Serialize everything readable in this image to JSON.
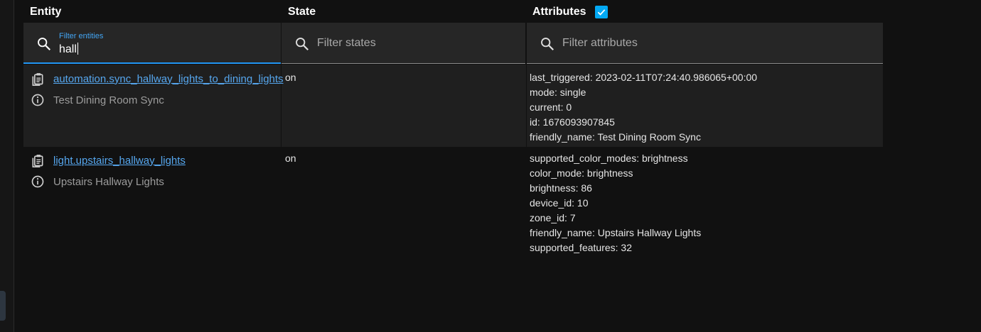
{
  "headers": {
    "entity": "Entity",
    "state": "State",
    "attributes": "Attributes",
    "attributes_checked": true
  },
  "filters": {
    "entity": {
      "label": "Filter entities",
      "value": "hall"
    },
    "state": {
      "placeholder": "Filter states"
    },
    "attributes": {
      "placeholder": "Filter attributes"
    }
  },
  "rows": [
    {
      "entity_id": "automation.sync_hallway_lights_to_dining_lights",
      "friendly_name": "Test Dining Room Sync",
      "state": "on",
      "attributes": [
        "last_triggered: 2023-02-11T07:24:40.986065+00:00",
        "mode: single",
        "current: 0",
        "id: 1676093907845",
        "friendly_name: Test Dining Room Sync"
      ]
    },
    {
      "entity_id": "light.upstairs_hallway_lights",
      "friendly_name": "Upstairs Hallway Lights",
      "state": "on",
      "attributes": [
        "supported_color_modes: brightness",
        "color_mode: brightness",
        "brightness: 86",
        "device_id: 10",
        "zone_id: 7",
        "friendly_name: Upstairs Hallway Lights",
        "supported_features: 32"
      ]
    }
  ],
  "icons": {
    "search": "search-icon",
    "copy": "clipboard-icon",
    "info": "info-icon",
    "check": "checkmark-icon"
  },
  "colors": {
    "accent": "#2196f3",
    "link": "#56a7ef"
  }
}
